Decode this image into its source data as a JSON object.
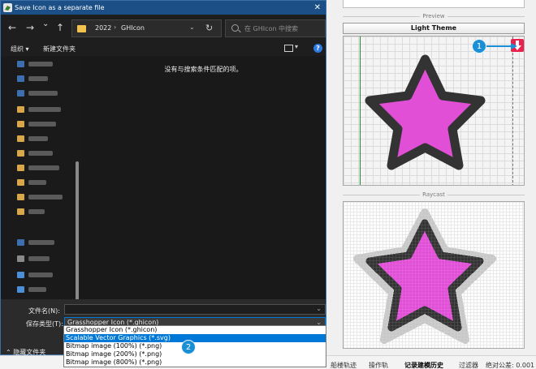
{
  "dialog": {
    "title": "Save Icon as a separate file",
    "nav": {
      "back": "←",
      "forward": "→",
      "dropdown": "⌄",
      "up": "↑"
    },
    "address": {
      "crumbs": [
        "2022",
        "GHIcon"
      ],
      "separator": "›"
    },
    "refresh": "↻",
    "search_placeholder": "在 GHIcon 中搜索",
    "toolbar": {
      "organize": "组织 ▾",
      "new_folder": "新建文件夹",
      "help": "?"
    },
    "empty_message": "没有与搜索条件匹配的项。",
    "filename_label": "文件名(N):",
    "filename_value": "",
    "filetype_label": "保存类型(T):",
    "filetype_value": "Grasshopper Icon (*.ghicon)",
    "hide_folders": "隐藏文件夹",
    "filetype_options": [
      "Grasshopper Icon (*.ghicon)",
      "Scalable Vector Graphics (*.svg)",
      "Bitmap image (100%) (*.png)",
      "Bitmap image (200%) (*.png)",
      "Bitmap image (800%) (*.png)"
    ],
    "selected_option_index": 1
  },
  "preview_panel": {
    "preview_label": "Preview",
    "theme_button": "Light Theme",
    "raycast_label": "Raycast",
    "star_fill": "#e04fd6",
    "star_outline": "#333333",
    "download_color": "#e8214d"
  },
  "callouts": [
    "1",
    "2"
  ],
  "bottom_tabs": [
    "船楼轨迹",
    "操作轨",
    "记录建模历史",
    "过滤器",
    "绝对公差: 0.001"
  ],
  "accent_colors": {
    "title_bar": "#1b4f86",
    "selection": "#0078d7",
    "callout": "#1a8fd6"
  }
}
